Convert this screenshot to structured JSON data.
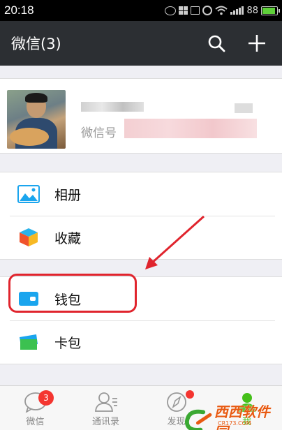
{
  "status_bar": {
    "time": "20:18",
    "battery_text": "88",
    "battery_level": 0.88
  },
  "header": {
    "title": "微信(3)",
    "search_icon": "search-icon",
    "add_icon": "plus-icon"
  },
  "profile": {
    "wechat_id_label": "微信号"
  },
  "menu": {
    "group1": [
      {
        "label": "相册",
        "icon": "photo-album-icon"
      },
      {
        "label": "收藏",
        "icon": "favorites-cube-icon"
      }
    ],
    "group2": [
      {
        "label": "钱包",
        "icon": "wallet-icon"
      },
      {
        "label": "卡包",
        "icon": "card-pack-icon"
      }
    ]
  },
  "tabs": [
    {
      "label": "微信",
      "badge": "3",
      "icon": "chat-bubble-icon"
    },
    {
      "label": "通讯录",
      "icon": "contacts-icon"
    },
    {
      "label": "发现",
      "icon": "compass-icon"
    },
    {
      "label": "我",
      "icon": "person-icon",
      "active": true
    }
  ],
  "watermark": {
    "text": "西西软件园",
    "sub": "CR173.COM"
  },
  "colors": {
    "header_bg": "#2c2f33",
    "accent_blue": "#1aa5ee",
    "highlight_red": "#e0242d",
    "active_green": "#45c01a",
    "badge_red": "#f43530"
  }
}
